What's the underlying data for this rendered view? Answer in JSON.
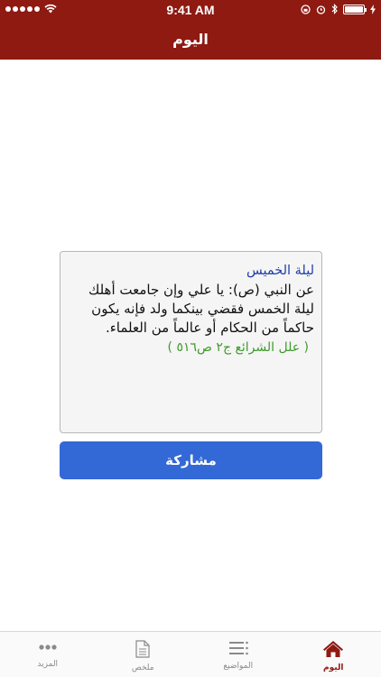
{
  "status_bar": {
    "time": "9:41 AM"
  },
  "header": {
    "title": "اليوم"
  },
  "card": {
    "title": "ليلة الخميس",
    "body": "عن النبي (ص): يا علي وإن جامعت أهلك ليلة الخمس فقضي بينكما ولد فإنه يكون حاكماً من الحكام أو عالماً من العلماء.",
    "source": "( علل الشرائع ج٢ ص٥١٦ )"
  },
  "share_button": {
    "label": "مشاركة"
  },
  "tabs": [
    {
      "label": "المزيد",
      "icon": "more-icon"
    },
    {
      "label": "ملخص",
      "icon": "document-icon"
    },
    {
      "label": "المواضيع",
      "icon": "list-icon"
    },
    {
      "label": "اليوم",
      "icon": "home-icon",
      "active": true
    }
  ],
  "colors": {
    "header": "#8e1a12",
    "card_title": "#1f3ea8",
    "card_source": "#3e9a2c",
    "button": "#3369d6",
    "active_tab": "#8e1a12"
  }
}
